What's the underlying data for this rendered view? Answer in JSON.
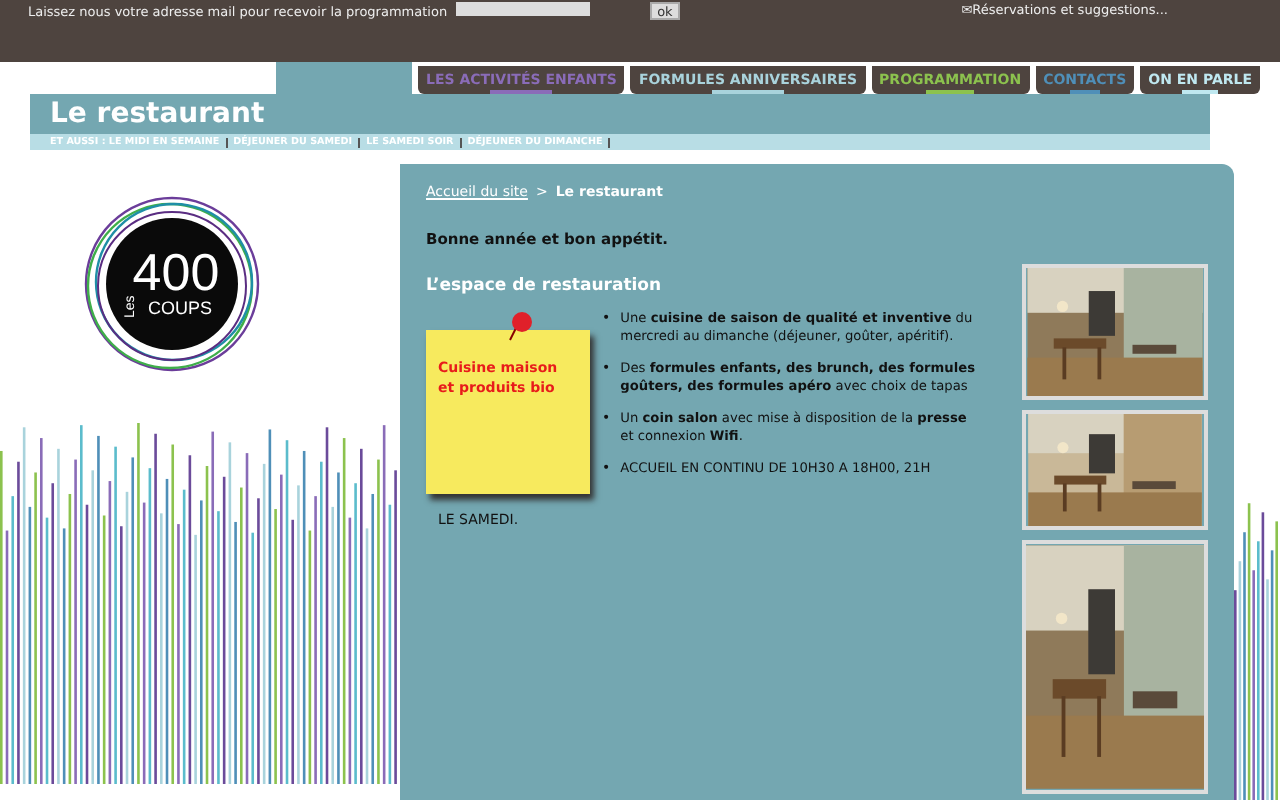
{
  "top_bar": {
    "newsletter_label": "Laissez nous votre adresse mail pour recevoir la programmation",
    "submit": "ok",
    "reservations_link": "✉Réservations et suggestions..."
  },
  "nav_tabs": [
    {
      "label": "LES ACTIVITÉS ENFANTS",
      "color": "#8a6cb8"
    },
    {
      "label": "FORMULES ANNIVERSAIRES",
      "color": "#a9d3dc"
    },
    {
      "label": "PROGRAMMATION",
      "color": "#8cc24e"
    },
    {
      "label": "CONTACTS",
      "color": "#4f8fb8"
    },
    {
      "label": "ON EN PARLE",
      "color": "#bfe8f0"
    }
  ],
  "page_title": "Le restaurant",
  "subnav": [
    "ET AUSSI : LE MIDI EN SEMAINE",
    "DÉJEUNER DU SAMEDI",
    "LE SAMEDI SOIR",
    "DÉJEUNER DU DIMANCHE"
  ],
  "logo": {
    "number": "400",
    "prefix": "Les",
    "suffix": "COUPS"
  },
  "breadcrumb": {
    "home": "Accueil du site",
    "separator": ">",
    "current": "Le restaurant"
  },
  "greeting": "Bonne année et bon appétit.",
  "section_title": "L’espace de restauration",
  "sticky_note": "Cuisine maison et produits bio",
  "bullet_marker": "•",
  "bullets": [
    "Une **cuisine de saison de qualité et inventive** du mercredi au dimanche (déjeuner, goûter, apéritif).",
    "Des **formules enfants, des brunch, des formules goûters, des formules apéro** avec choix de tapas",
    "Un **coin salon** avec mise à disposition de la **presse** et connexion **Wifi**.",
    "ACCUEIL EN CONTINU DE 10H30 A 18H00, 21H"
  ],
  "trailing_text": "LE SAMEDI.",
  "photos": [
    {
      "kind": "picture"
    },
    {
      "kind": "picture"
    },
    {
      "kind": "picture"
    }
  ]
}
